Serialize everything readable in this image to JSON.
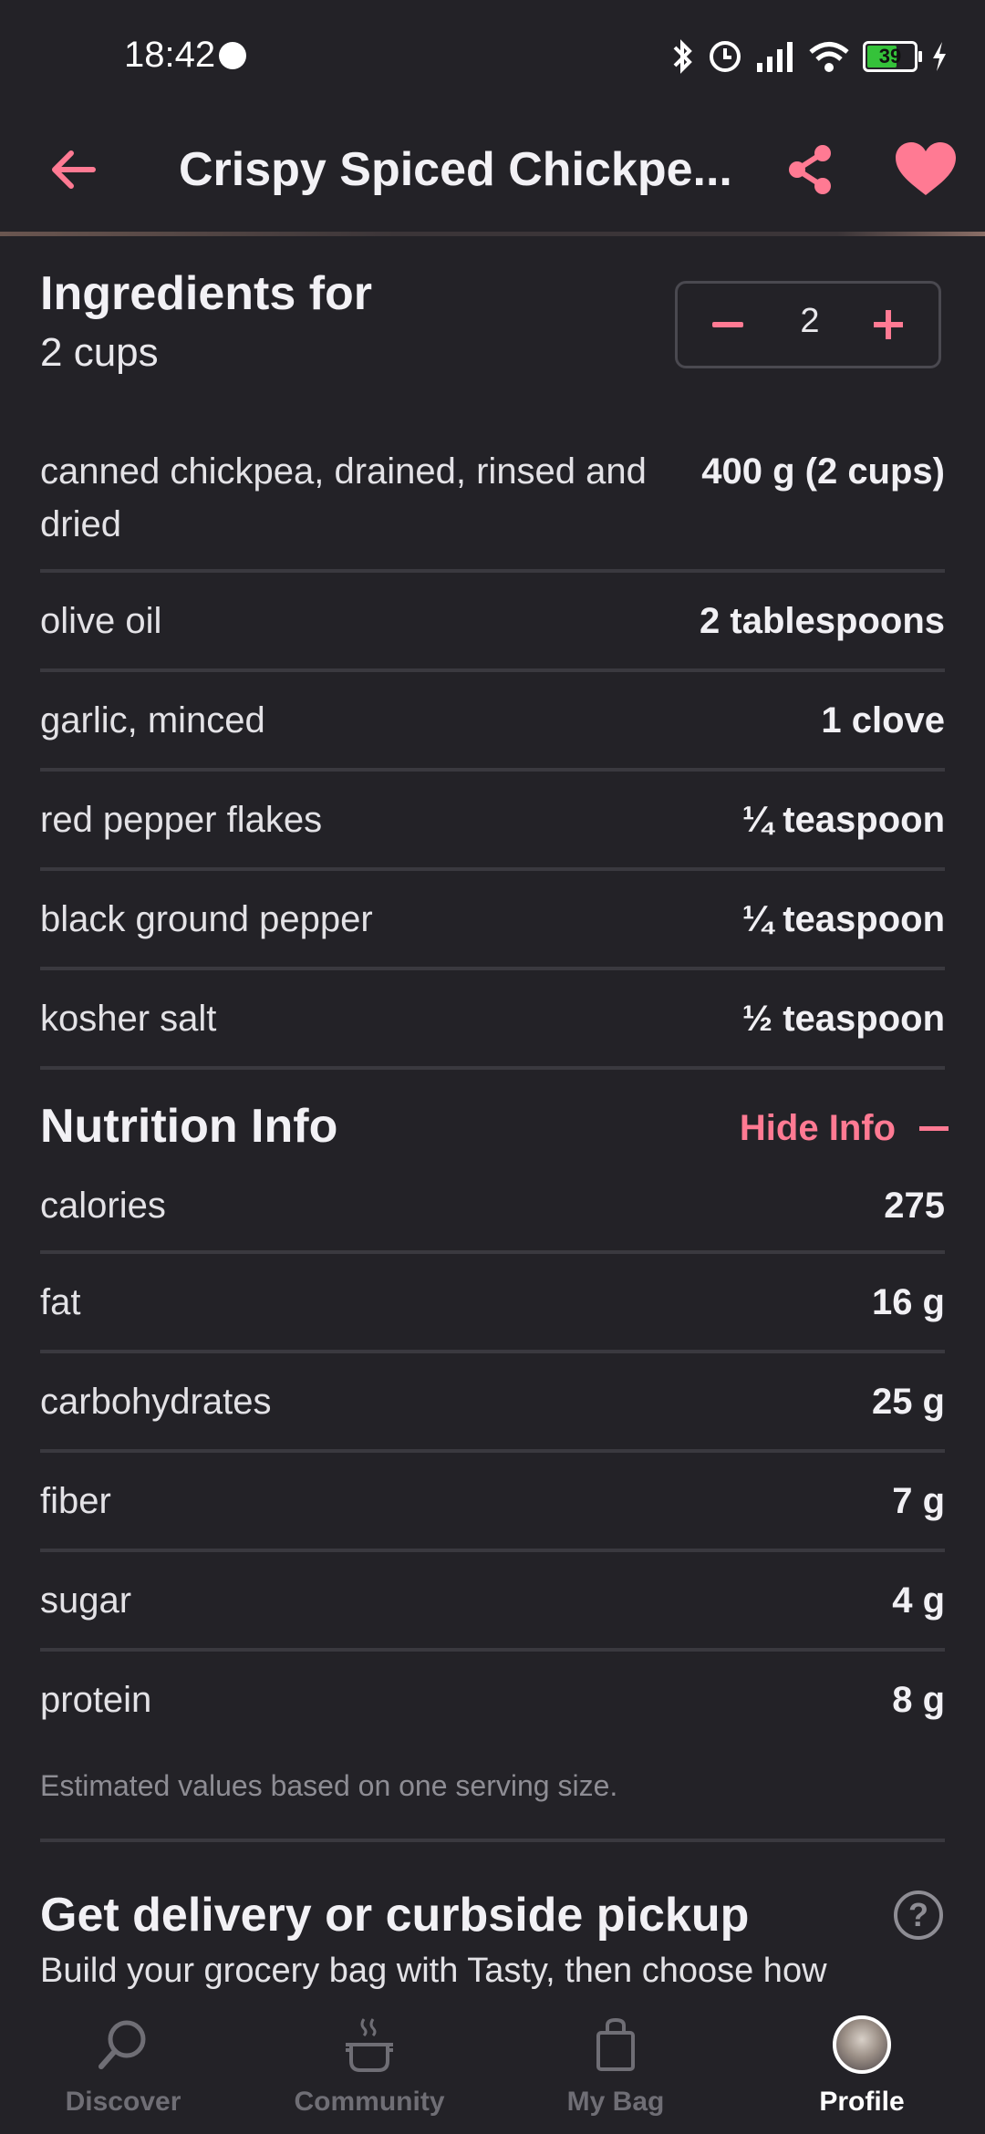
{
  "status_bar": {
    "time": "18:42",
    "battery": "39"
  },
  "header": {
    "title": "Crispy Spiced Chickpe..."
  },
  "ingredients": {
    "title": "Ingredients for",
    "yield": "2 cups",
    "servings": "2",
    "items": [
      {
        "name": "canned chickpea, drained, rinsed and dried",
        "amount": "400 g (2 cups)"
      },
      {
        "name": "olive oil",
        "amount": "2 tablespoons"
      },
      {
        "name": "garlic, minced",
        "amount": "1 clove"
      },
      {
        "name": "red pepper flakes",
        "amount": "¼ teaspoon"
      },
      {
        "name": "black ground pepper",
        "amount": "¼ teaspoon"
      },
      {
        "name": "kosher salt",
        "amount": "½ teaspoon"
      }
    ]
  },
  "nutrition": {
    "title": "Nutrition Info",
    "toggle_label": "Hide Info",
    "items": [
      {
        "name": "calories",
        "value": "275"
      },
      {
        "name": "fat",
        "value": "16 g"
      },
      {
        "name": "carbohydrates",
        "value": "25 g"
      },
      {
        "name": "fiber",
        "value": "7 g"
      },
      {
        "name": "sugar",
        "value": "4 g"
      },
      {
        "name": "protein",
        "value": "8 g"
      }
    ],
    "note": "Estimated values based on one serving size."
  },
  "delivery": {
    "title": "Get delivery or curbside pickup",
    "text": "Build your grocery bag with Tasty, then choose how"
  },
  "bottom_nav": [
    {
      "label": "Discover",
      "icon": "search-icon"
    },
    {
      "label": "Community",
      "icon": "pot-icon"
    },
    {
      "label": "My Bag",
      "icon": "bag-icon"
    },
    {
      "label": "Profile",
      "icon": "avatar"
    }
  ],
  "colors": {
    "accent": "#ff7a93",
    "background": "#232227",
    "divider": "#3a393f"
  }
}
